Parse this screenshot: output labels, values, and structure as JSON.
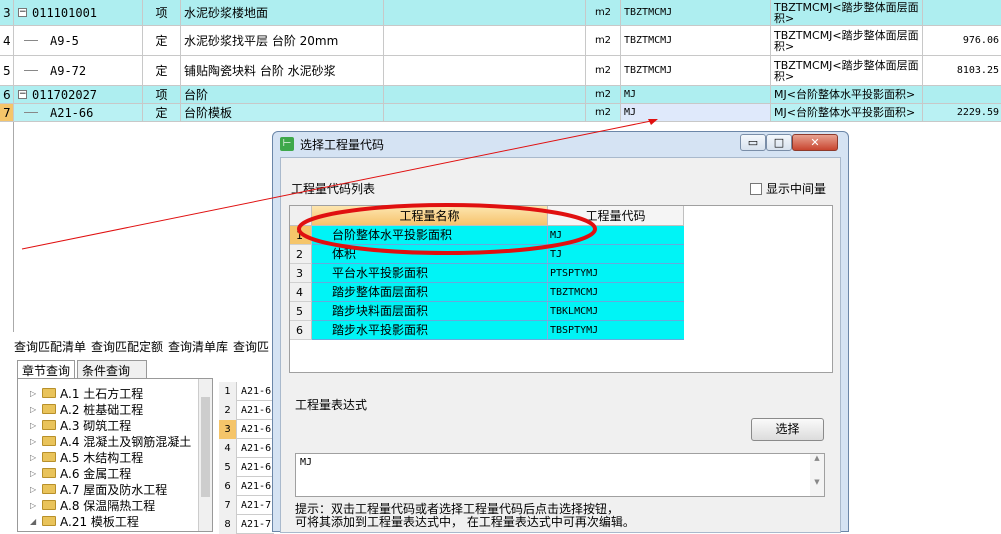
{
  "top_grid": {
    "rows": [
      {
        "idx": "3",
        "code": "011101001",
        "type": "项",
        "name": "水泥砂浆楼地面",
        "unit": "m2",
        "qcode": "TBZTMCMJ",
        "expr": "TBZTMCMJ<踏步整体面层面积>",
        "value": "",
        "tree": "minus"
      },
      {
        "idx": "4",
        "code": "A9-5",
        "type": "定",
        "name": "水泥砂浆找平层 台阶 20mm",
        "unit": "m2",
        "qcode": "TBZTMCMJ",
        "expr": "TBZTMCMJ<踏步整体面层面积>",
        "value": "976.06",
        "tree": "line"
      },
      {
        "idx": "5",
        "code": "A9-72",
        "type": "定",
        "name": "铺贴陶瓷块料 台阶 水泥砂浆",
        "unit": "m2",
        "qcode": "TBZTMCMJ",
        "expr": "TBZTMCMJ<踏步整体面层面积>",
        "value": "8103.25",
        "tree": "line"
      },
      {
        "idx": "6",
        "code": "011702027",
        "type": "项",
        "name": "台阶",
        "unit": "m2",
        "qcode": "MJ",
        "expr": "MJ<台阶整体水平投影面积>",
        "value": "",
        "tree": "minus"
      },
      {
        "idx": "7",
        "code": "A21-66",
        "type": "定",
        "name": "台阶模板",
        "unit": "m2",
        "qcode": "MJ",
        "expr": "MJ<台阶整体水平投影面积>",
        "value": "2229.59",
        "tree": "line"
      }
    ]
  },
  "bottom_tabs": [
    "查询匹配清单",
    "查询匹配定额",
    "查询清单库",
    "查询匹"
  ],
  "sub_tabs": [
    "章节查询",
    "条件查询"
  ],
  "tree_items": [
    {
      "label": "A.1 土石方工程"
    },
    {
      "label": "A.2 桩基础工程"
    },
    {
      "label": "A.3 砌筑工程"
    },
    {
      "label": "A.4 混凝土及钢筋混凝土"
    },
    {
      "label": "A.5 木结构工程"
    },
    {
      "label": "A.6 金属工程"
    },
    {
      "label": "A.7 屋面及防水工程"
    },
    {
      "label": "A.8 保温隔热工程"
    },
    {
      "label": "A.21 模板工程"
    }
  ],
  "mini_grid": [
    {
      "n": "1",
      "v": "A21-6"
    },
    {
      "n": "2",
      "v": "A21-6"
    },
    {
      "n": "3",
      "v": "A21-6"
    },
    {
      "n": "4",
      "v": "A21-6"
    },
    {
      "n": "5",
      "v": "A21-6"
    },
    {
      "n": "6",
      "v": "A21-6"
    },
    {
      "n": "7",
      "v": "A21-7"
    },
    {
      "n": "8",
      "v": "A21-7"
    }
  ],
  "dialog": {
    "title": "选择工程量代码",
    "btn_min": "▭",
    "btn_max": "□",
    "btn_close": "✕",
    "icon_glyph": "⊢",
    "list_label": "工程量代码列表",
    "show_middle_label": "显示中间量",
    "table": {
      "col_name": "工程量名称",
      "col_code": "工程量代码",
      "rows": [
        {
          "i": "1",
          "name": "台阶整体水平投影面积",
          "code": "MJ"
        },
        {
          "i": "2",
          "name": "体积",
          "code": "TJ"
        },
        {
          "i": "3",
          "name": "平台水平投影面积",
          "code": "PTSPTYMJ"
        },
        {
          "i": "4",
          "name": "踏步整体面层面积",
          "code": "TBZTMCMJ"
        },
        {
          "i": "5",
          "name": "踏步块料面层面积",
          "code": "TBKLMCMJ"
        },
        {
          "i": "6",
          "name": "踏步水平投影面积",
          "code": "TBSPTYMJ"
        }
      ]
    },
    "expr_label": "工程量表达式",
    "select_button": "选择",
    "expr_value": "MJ",
    "hint_line1": "提示：双击工程量代码或者选择工程量代码后点击选择按钮，",
    "hint_line2": "可将其添加到工程量表达式中， 在工程量表达式中可再次编辑。"
  },
  "colors": {
    "cyan_row": "#00f4f6",
    "header_orange": "#f6c36d",
    "annotation_red": "#e01010",
    "dialog_frame": "#d5e3f3"
  }
}
